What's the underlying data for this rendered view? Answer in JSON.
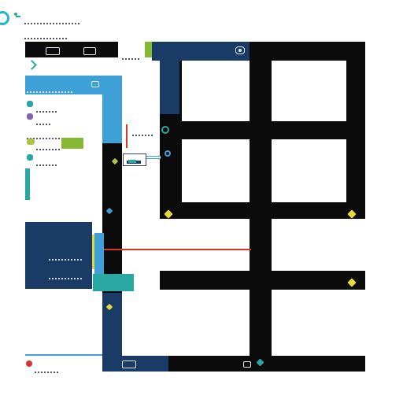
{
  "top_bar": {
    "brand_icon": "ring-logo",
    "brand_color": "#1bb6c9",
    "small_icons": [
      "user-key-icon"
    ],
    "title_text": "",
    "subtitle_text": ""
  },
  "panels": {
    "left_panel": {
      "header_color": "#3f9fd7",
      "list_icons": [
        "teal-dot-icon",
        "purple-dot-icon",
        "green-dot-icon",
        "teal-dot-icon"
      ],
      "lower_panel_color": "#1b3b67",
      "lower_panel_label": ""
    },
    "map_grid": {
      "grid_color": "#0b0b0b",
      "window_color": "#ffffff"
    }
  },
  "accents": {
    "accent_green": "#86b933",
    "accent_teal": "#2aa7a3",
    "accent_red": "#d9342b",
    "accent_yellow": "#e3d93f"
  },
  "icons": {
    "top_right_icon": "compass-icon",
    "sensor_icon": "target-icon",
    "diamond_markers": [
      "yellow-diamond-icon",
      "yellow-diamond-icon",
      "yellow-diamond-icon"
    ],
    "bottom_icons": [
      "image-icon",
      "teal-diamond-icon"
    ]
  }
}
